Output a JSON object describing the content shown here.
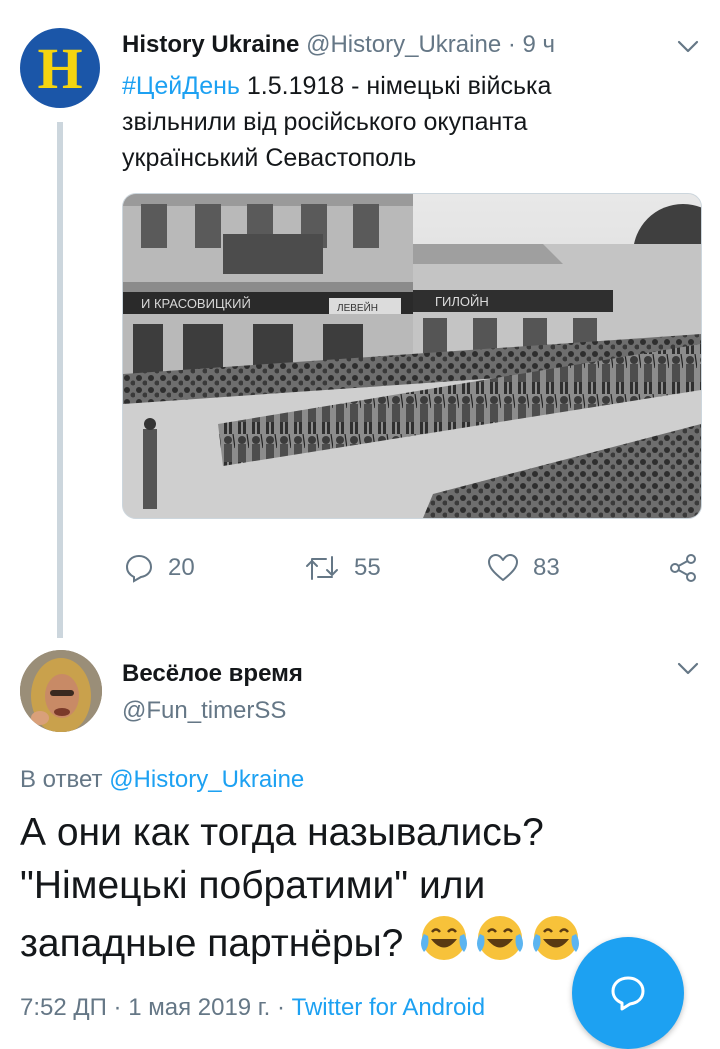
{
  "parent_tweet": {
    "avatar_letter": "H",
    "display_name": "History Ukraine",
    "handle": "@History_Ukraine",
    "separator": "·",
    "time": "9 ч",
    "hashtag": "#ЦейДень",
    "text_line1": " 1.5.1918 - німецькі війська",
    "text_line2": "звільнили від російського окупанта",
    "text_line3": "український Севастополь",
    "photo_sign_left": "И КРАСОВИЦКИЙ",
    "photo_sign_mid": "ЛЕВЕЙН",
    "photo_sign_right": "ГИЛОЙН",
    "actions": {
      "reply_count": "20",
      "retweet_count": "55",
      "like_count": "83"
    }
  },
  "reply_tweet": {
    "display_name": "Весёлое время",
    "handle": "@Fun_timerSS",
    "reply_prefix": "В ответ ",
    "reply_mention": "@History_Ukraine",
    "text_line1": "А они как тогда назывались?",
    "text_line2": "\"Німецькі побратими\" или",
    "text_line3": "западные партнёры?",
    "emoji_name": "face-with-tears-of-joy",
    "time": "7:52 ДП",
    "dot": " · ",
    "date": "1 мая 2019 г.",
    "source": "Twitter for Android"
  },
  "colors": {
    "accent": "#1da1f2",
    "secondary_text": "#657786",
    "primary_text": "#14171a",
    "thread_line": "#ccd6dd",
    "avatar_bg": "#1b56a8",
    "avatar_letter": "#f5d40f"
  },
  "icons": [
    "reply-icon",
    "retweet-icon",
    "like-icon",
    "share-icon",
    "caret-down-icon",
    "compose-reply-icon"
  ]
}
